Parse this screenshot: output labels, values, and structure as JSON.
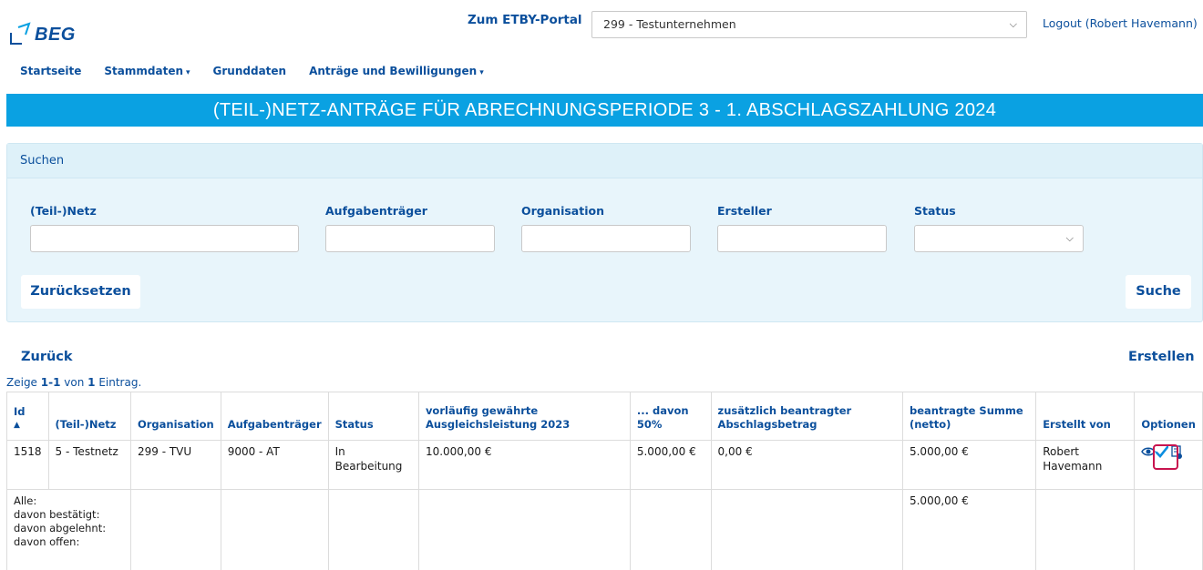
{
  "header": {
    "logo_text": "BEG",
    "portal_link": "Zum ETBY-Portal",
    "company_selected": "299 - Testunternehmen",
    "logout": "Logout (Robert Havemann)"
  },
  "nav": {
    "items": [
      {
        "label": "Startseite",
        "dropdown": false
      },
      {
        "label": "Stammdaten",
        "dropdown": true
      },
      {
        "label": "Grunddaten",
        "dropdown": false
      },
      {
        "label": "Anträge und Bewilligungen",
        "dropdown": true
      }
    ]
  },
  "banner": {
    "title": "(TEIL-)NETZ-ANTRÄGE FÜR ABRECHNUNGSPERIODE 3 - 1. ABSCHLAGSZAHLUNG 2024"
  },
  "search": {
    "panel_title": "Suchen",
    "fields": {
      "netz": {
        "label": "(Teil-)Netz",
        "value": ""
      },
      "aufgabentraeger": {
        "label": "Aufgabenträger",
        "value": ""
      },
      "organisation": {
        "label": "Organisation",
        "value": ""
      },
      "ersteller": {
        "label": "Ersteller",
        "value": ""
      },
      "status": {
        "label": "Status",
        "value": ""
      }
    },
    "reset_button": "Zurücksetzen",
    "search_button": "Suche"
  },
  "actions": {
    "back": "Zurück",
    "create": "Erstellen"
  },
  "summary": {
    "prefix": "Zeige ",
    "range": "1-1",
    "middle": " von ",
    "total": "1",
    "suffix": " Eintrag."
  },
  "table": {
    "headers": {
      "id": "Id",
      "netz": "(Teil-)Netz",
      "organisation": "Organisation",
      "aufgabentraeger": "Aufgabenträger",
      "status": "Status",
      "vorlaeufig": "vorläufig gewährte Ausgleichsleistung 2023",
      "davon50": "... davon 50%",
      "zusaetzlich": "zusätzlich beantragter Abschlagsbetrag",
      "summe": "beantragte Summe (netto)",
      "erstellt": "Erstellt von",
      "optionen": "Optionen"
    },
    "rows": [
      {
        "id": "1518",
        "netz": "5 - Testnetz",
        "organisation": "299 - TVU",
        "aufgabentraeger": "9000 - AT",
        "status": "In Bearbeitung",
        "vorlaeufig": "10.000,00 €",
        "davon50": "5.000,00 €",
        "zusaetzlich": "0,00 €",
        "summe": "5.000,00 €",
        "erstellt": "Robert Havemann",
        "icons": [
          "eye-icon",
          "check-icon",
          "document-icon"
        ]
      }
    ],
    "totals": {
      "alle": "Alle:",
      "bestaetigt": "davon bestätigt:",
      "abgelehnt": "davon abgelehnt:",
      "offen": "davon offen:",
      "summe": "5.000,00 €"
    }
  },
  "colors": {
    "brand_blue": "#0b4f9c",
    "banner": "#0aa1e2",
    "panel_bg": "#e8f5fb",
    "highlight": "#c8134e"
  }
}
